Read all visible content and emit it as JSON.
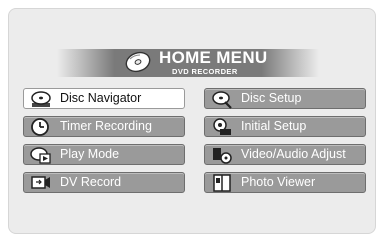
{
  "header": {
    "title": "HOME MENU",
    "subtitle": "DVD RECORDER"
  },
  "menu": {
    "left": [
      {
        "label": "Disc Navigator",
        "icon": "disc-navigator-icon",
        "selected": true
      },
      {
        "label": "Timer Recording",
        "icon": "clock-icon",
        "selected": false
      },
      {
        "label": "Play Mode",
        "icon": "play-mode-icon",
        "selected": false
      },
      {
        "label": "DV Record",
        "icon": "dv-record-icon",
        "selected": false
      }
    ],
    "right": [
      {
        "label": "Disc Setup",
        "icon": "disc-setup-icon",
        "selected": false
      },
      {
        "label": "Initial Setup",
        "icon": "initial-setup-icon",
        "selected": false
      },
      {
        "label": "Video/Audio Adjust",
        "icon": "video-audio-adjust-icon",
        "selected": false
      },
      {
        "label": "Photo Viewer",
        "icon": "photo-viewer-icon",
        "selected": false
      }
    ]
  },
  "colors": {
    "button": "#9a9a9a",
    "selected": "#ffffff",
    "header_band": "#7a7a7a",
    "background": "#ececec"
  }
}
